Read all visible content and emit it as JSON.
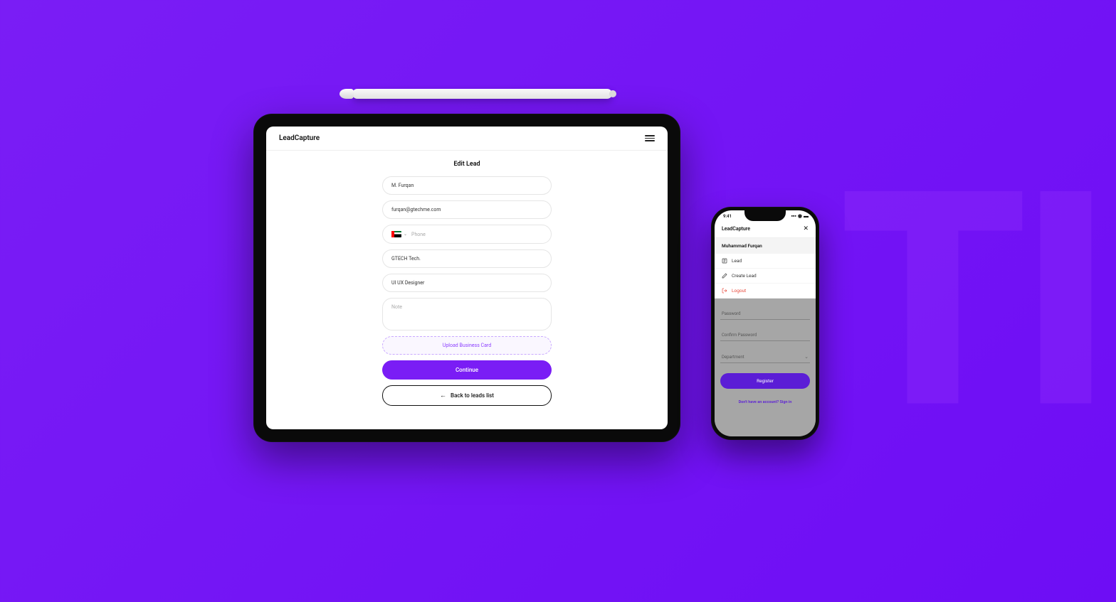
{
  "tablet": {
    "brand": "LeadCapture",
    "page_title": "Edit Lead",
    "fields": {
      "name": "M. Furqan",
      "email": "furqan@gtechme.com",
      "phone_placeholder": "Phone",
      "company": "GTECH Tech.",
      "role": "UI UX Designer",
      "note_placeholder": "Note"
    },
    "upload_label": "Upload Business Card",
    "continue_label": "Continue",
    "back_label": "Back to leads list"
  },
  "phone": {
    "time": "9:41",
    "brand": "LeadCapture",
    "user": "Muhammad Furqan",
    "menu": {
      "lead": "Lead",
      "create_lead": "Create Lead",
      "logout": "Logout"
    },
    "overlay": {
      "password": "Password",
      "confirm": "Confirm Password",
      "department": "Department",
      "register": "Register",
      "signin_prompt": "Don't have an account?",
      "signin_link": "Sign in"
    }
  }
}
